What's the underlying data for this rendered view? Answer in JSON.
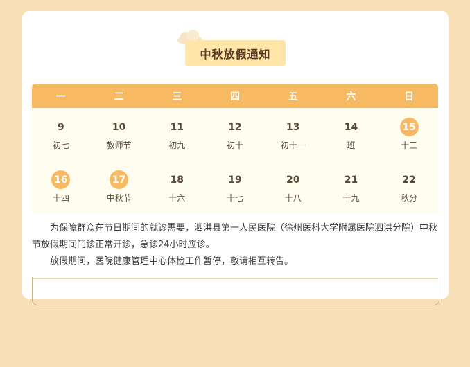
{
  "title": "中秋放假通知",
  "weekdays": [
    "一",
    "二",
    "三",
    "四",
    "五",
    "六",
    "日"
  ],
  "rows": [
    [
      {
        "day": "9",
        "label": "初七",
        "hl": false
      },
      {
        "day": "10",
        "label": "教师节",
        "hl": false
      },
      {
        "day": "11",
        "label": "初九",
        "hl": false
      },
      {
        "day": "12",
        "label": "初十",
        "hl": false
      },
      {
        "day": "13",
        "label": "初十一",
        "hl": false
      },
      {
        "day": "14",
        "label": "班",
        "hl": false
      },
      {
        "day": "15",
        "label": "十三",
        "hl": true
      }
    ],
    [
      {
        "day": "16",
        "label": "十四",
        "hl": true
      },
      {
        "day": "17",
        "label": "中秋节",
        "hl": true
      },
      {
        "day": "18",
        "label": "十六",
        "hl": false
      },
      {
        "day": "19",
        "label": "十七",
        "hl": false
      },
      {
        "day": "20",
        "label": "十八",
        "hl": false
      },
      {
        "day": "21",
        "label": "十九",
        "hl": false
      },
      {
        "day": "22",
        "label": "秋分",
        "hl": false
      }
    ]
  ],
  "paragraphs": [
    "为保障群众在节日期间的就诊需要，泗洪县第一人民医院（徐州医科大学附属医院泗洪分院）中秋节放假期间门诊正常开诊，急诊24小时应诊。",
    "放假期间，医院健康管理中心体检工作暂停，敬请相互转告。"
  ],
  "colors": {
    "accent": "#f8b963",
    "title_bg": "#fde6a8",
    "page_bg": "#f8dfb6"
  }
}
